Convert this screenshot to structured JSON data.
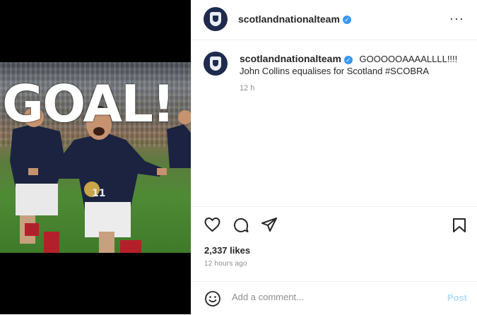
{
  "post": {
    "goal_overlay": "GOAL!",
    "header": {
      "username": "scotlandnationalteam",
      "more": "···"
    },
    "caption": {
      "username": "scotlandnationalteam",
      "text_line1": "GOOOOOAAAALLLL!!!!",
      "text_line2": "John Collins equalises for Scotland #SCOBRA",
      "time": "12 h"
    },
    "likes": "2,337 likes",
    "posted_ago": "12 hours ago",
    "comment": {
      "placeholder": "Add a comment...",
      "post_label": "Post"
    },
    "icons": [
      "heart-icon",
      "comment-icon",
      "share-icon",
      "bookmark-icon",
      "emoji-icon"
    ],
    "colors": {
      "verified": "#3897f0",
      "post_button": "#b2dffc",
      "kit_navy": "#1f2b4d"
    }
  }
}
